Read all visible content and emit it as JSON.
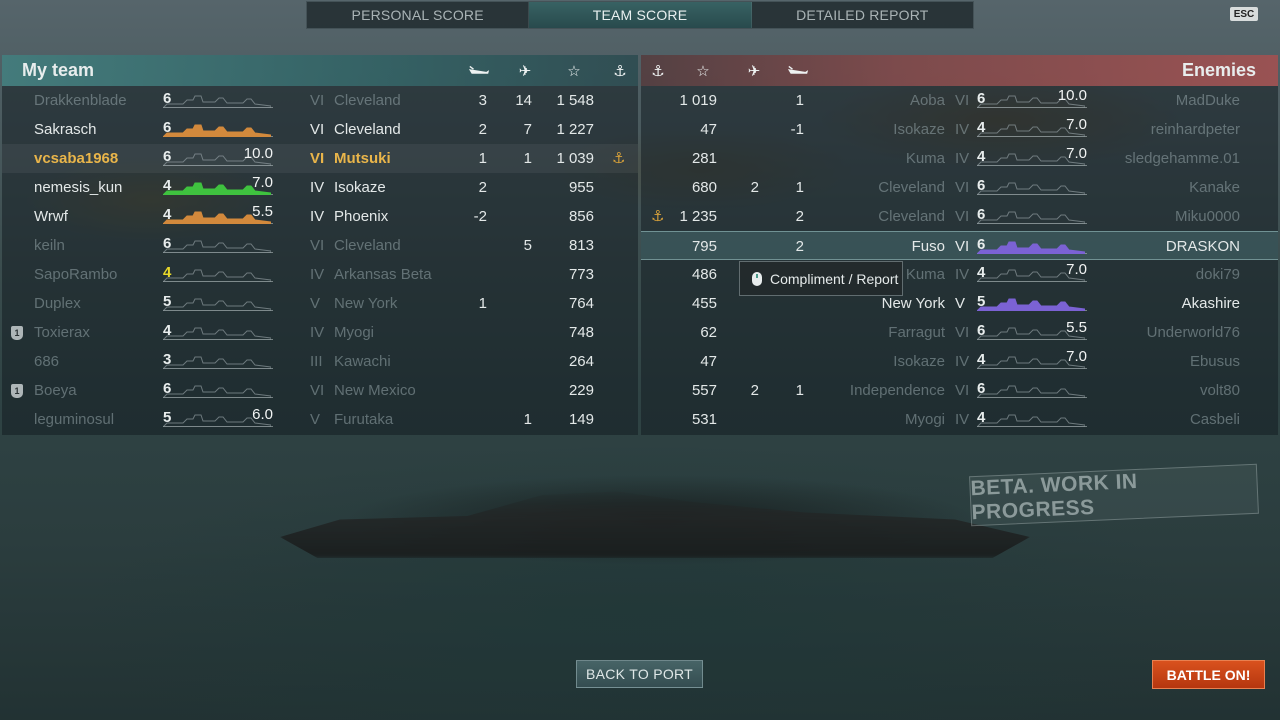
{
  "tabs": [
    {
      "label": "PERSONAL SCORE",
      "active": false
    },
    {
      "label": "TEAM SCORE",
      "active": true
    },
    {
      "label": "DETAILED REPORT",
      "active": false
    }
  ],
  "esc_label": "ESC",
  "my_team": {
    "title": "My team",
    "header_icons": [
      "sunk-ship-icon",
      "planes-destroyed-icon",
      "star-icon",
      "anchor-icon"
    ],
    "rows": [
      {
        "name": "Drakkenblade",
        "tier_icon": "6",
        "ship_score": "",
        "tier": "VI",
        "ship": "Cleveland",
        "kills": "3",
        "planes": "14",
        "xp": "1 548",
        "dim": true,
        "bar_color": "#8e9a9e"
      },
      {
        "name": "Sakrasch",
        "tier_icon": "6",
        "ship_score": "",
        "tier": "VI",
        "ship": "Cleveland",
        "kills": "2",
        "planes": "7",
        "xp": "1 227",
        "dim": false,
        "bar_color": "#d2893c"
      },
      {
        "name": "vcsaba1968",
        "tier_icon": "6",
        "ship_score": "10.0",
        "tier": "VI",
        "ship": "Mutsuki",
        "kills": "1",
        "planes": "1",
        "xp": "1 039",
        "dim": false,
        "gold": true,
        "anchor": true,
        "bar_color": "#8e9a9e"
      },
      {
        "name": "nemesis_kun",
        "tier_icon": "4",
        "ship_score": "7.0",
        "tier": "IV",
        "ship": "Isokaze",
        "kills": "2",
        "planes": "",
        "xp": "955",
        "dim": false,
        "bar_color": "#3fc23f"
      },
      {
        "name": "Wrwf",
        "tier_icon": "4",
        "ship_score": "5.5",
        "tier": "IV",
        "ship": "Phoenix",
        "kills": "-2",
        "planes": "",
        "xp": "856",
        "dim": false,
        "bar_color": "#d2893c"
      },
      {
        "name": "keiln",
        "tier_icon": "6",
        "ship_score": "",
        "tier": "VI",
        "ship": "Cleveland",
        "kills": "",
        "planes": "5",
        "xp": "813",
        "dim": true,
        "bar_color": "#8e9a9e"
      },
      {
        "name": "SapoRambo",
        "tier_icon": "4",
        "ship_score": "",
        "tier": "IV",
        "ship": "Arkansas Beta",
        "kills": "",
        "planes": "",
        "xp": "773",
        "dim": true,
        "yellow": true,
        "bar_color": "#8e9a9e"
      },
      {
        "name": "Duplex",
        "tier_icon": "5",
        "ship_score": "",
        "tier": "V",
        "ship": "New York",
        "kills": "1",
        "planes": "",
        "xp": "764",
        "dim": true,
        "bar_color": "#8e9a9e"
      },
      {
        "name": "Toxierax",
        "tier_icon": "4",
        "ship_score": "",
        "tier": "IV",
        "ship": "Myogi",
        "kills": "",
        "planes": "",
        "xp": "748",
        "dim": true,
        "badge": "1",
        "bar_color": "#8e9a9e"
      },
      {
        "name": "686",
        "tier_icon": "3",
        "ship_score": "",
        "tier": "III",
        "ship": "Kawachi",
        "kills": "",
        "planes": "",
        "xp": "264",
        "dim": true,
        "bar_color": "#8e9a9e"
      },
      {
        "name": "Boeya",
        "tier_icon": "6",
        "ship_score": "",
        "tier": "VI",
        "ship": "New Mexico",
        "kills": "",
        "planes": "",
        "xp": "229",
        "dim": true,
        "badge": "1",
        "bar_color": "#8e9a9e"
      },
      {
        "name": "leguminosul",
        "tier_icon": "5",
        "ship_score": "6.0",
        "tier": "V",
        "ship": "Furutaka",
        "kills": "",
        "planes": "1",
        "xp": "149",
        "dim": true,
        "bar_color": "#8e9a9e"
      }
    ]
  },
  "enemies": {
    "title": "Enemies",
    "header_icons": [
      "anchor-icon",
      "star-icon",
      "planes-destroyed-icon",
      "sunk-ship-icon"
    ],
    "rows": [
      {
        "xp": "1 019",
        "planes": "",
        "kills": "1",
        "ship": "Aoba",
        "tier": "VI",
        "tier_icon": "6",
        "ship_score": "10.0",
        "name": "MadDuke",
        "dim": true,
        "bar_color": "#8e9a9e"
      },
      {
        "xp": "47",
        "planes": "",
        "kills": "-1",
        "ship": "Isokaze",
        "tier": "IV",
        "tier_icon": "4",
        "ship_score": "7.0",
        "name": "reinhardpeter",
        "dim": true,
        "bar_color": "#8e9a9e"
      },
      {
        "xp": "281",
        "planes": "",
        "kills": "",
        "ship": "Kuma",
        "tier": "IV",
        "tier_icon": "4",
        "ship_score": "7.0",
        "name": "sledgehamme.01",
        "dim": true,
        "bar_color": "#8e9a9e"
      },
      {
        "xp": "680",
        "planes": "2",
        "kills": "1",
        "ship": "Cleveland",
        "tier": "VI",
        "tier_icon": "6",
        "ship_score": "",
        "name": "Kanake",
        "dim": true,
        "bar_color": "#8e9a9e"
      },
      {
        "xp": "1 235",
        "planes": "",
        "kills": "2",
        "ship": "Cleveland",
        "tier": "VI",
        "tier_icon": "6",
        "ship_score": "",
        "name": "Miku0000",
        "dim": true,
        "anchor": true,
        "bar_color": "#8e9a9e"
      },
      {
        "xp": "795",
        "planes": "",
        "kills": "2",
        "ship": "Fuso",
        "tier": "VI",
        "tier_icon": "6",
        "ship_score": "",
        "name": "DRASKON",
        "dim": false,
        "selected": true,
        "bar_color": "#7b62d4"
      },
      {
        "xp": "486",
        "planes": "",
        "kills": "",
        "ship": "Kuma",
        "tier": "IV",
        "tier_icon": "4",
        "ship_score": "7.0",
        "name": "doki79",
        "dim": true,
        "bar_color": "#8e9a9e"
      },
      {
        "xp": "455",
        "planes": "",
        "kills": "",
        "ship": "New York",
        "tier": "V",
        "tier_icon": "5",
        "ship_score": "",
        "name": "Akashire",
        "dim": false,
        "bar_color": "#7b62d4"
      },
      {
        "xp": "62",
        "planes": "",
        "kills": "",
        "ship": "Farragut",
        "tier": "VI",
        "tier_icon": "6",
        "ship_score": "5.5",
        "name": "Underworld76",
        "dim": true,
        "bar_color": "#8e9a9e"
      },
      {
        "xp": "47",
        "planes": "",
        "kills": "",
        "ship": "Isokaze",
        "tier": "IV",
        "tier_icon": "4",
        "ship_score": "7.0",
        "name": "Ebusus",
        "dim": true,
        "bar_color": "#8e9a9e"
      },
      {
        "xp": "557",
        "planes": "2",
        "kills": "1",
        "ship": "Independence",
        "tier": "VI",
        "tier_icon": "6",
        "ship_score": "",
        "name": "volt80",
        "dim": true,
        "bar_color": "#8e9a9e"
      },
      {
        "xp": "531",
        "planes": "",
        "kills": "",
        "ship": "Myogi",
        "tier": "IV",
        "tier_icon": "4",
        "ship_score": "",
        "name": "Casbeli",
        "dim": true,
        "bar_color": "#8e9a9e"
      }
    ]
  },
  "tooltip": {
    "label": "Compliment / Report",
    "icon": "mouse-icon"
  },
  "watermark": "BETA. WORK IN PROGRESS",
  "buttons": {
    "back": "BACK TO PORT",
    "battle": "BATTLE ON!"
  }
}
